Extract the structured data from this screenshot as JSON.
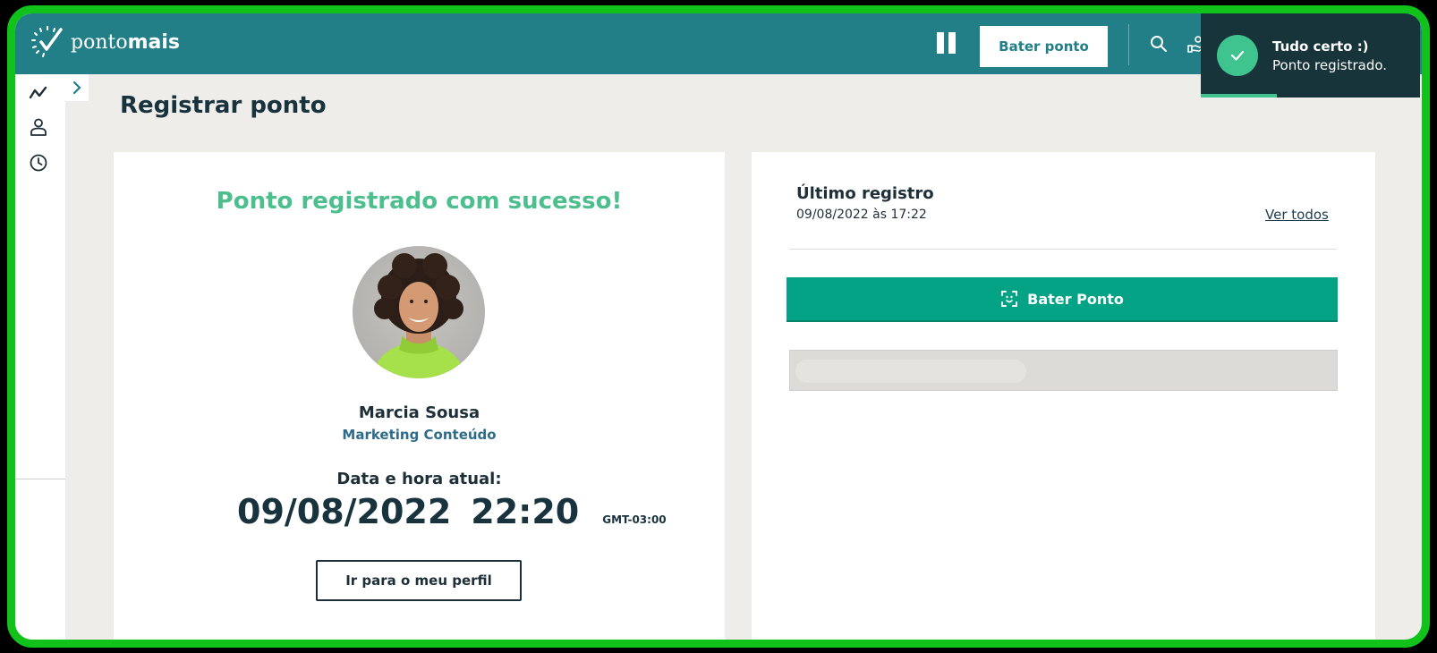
{
  "header": {
    "brand_prefix": "ponto",
    "brand_suffix": "mais",
    "bater_ponto_label": "Bater ponto",
    "icons": [
      "pause-icon",
      "search-icon",
      "hand-icon"
    ]
  },
  "toast": {
    "title": "Tudo certo :)",
    "message": "Ponto registrado.",
    "icon": "check-icon",
    "color": "#3fc48f"
  },
  "sidebar": {
    "items": [
      {
        "icon": "chart-line-icon"
      },
      {
        "icon": "user-icon"
      },
      {
        "icon": "clock-icon"
      }
    ]
  },
  "page": {
    "title": "Registrar ponto"
  },
  "registro": {
    "success_message": "Ponto registrado com sucesso!",
    "user_name": "Marcia Sousa",
    "user_department": "Marketing Conteúdo",
    "datetime_label": "Data e hora atual:",
    "date": "09/08/2022",
    "time": "22:20",
    "timezone": "GMT-03:00",
    "profile_button": "Ir para o meu perfil"
  },
  "ultimo": {
    "label": "Último registro",
    "value": "09/08/2022 às 17:22",
    "ver_todos": "Ver todos",
    "bater_ponto_label": "Bater Ponto"
  },
  "colors": {
    "topbar": "#227f87",
    "accent": "#04a386",
    "success_text": "#4dbf8e",
    "frame": "#10c21a"
  }
}
